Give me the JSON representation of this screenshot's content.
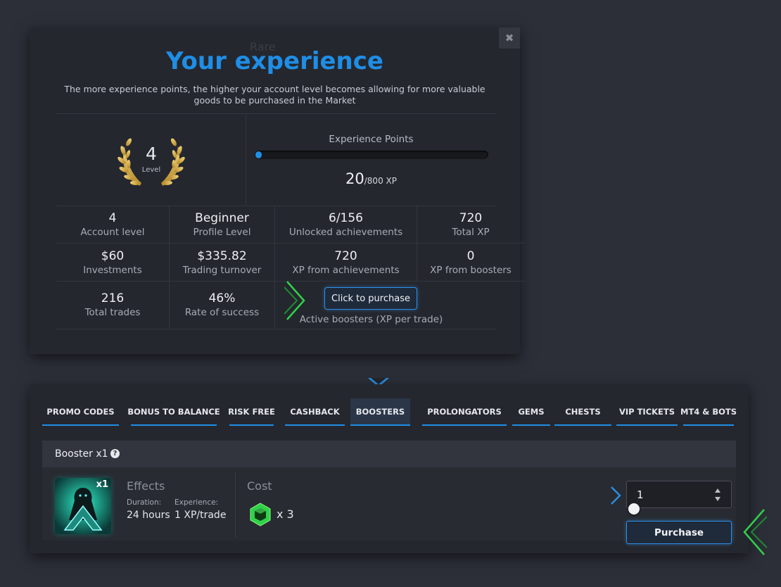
{
  "modal": {
    "bg_text": "Rare",
    "close_glyph": "✖",
    "title": "Your experience",
    "description": "The more experience points, the higher your account level becomes allowing for more valuable goods to be purchased in the Market",
    "level": {
      "value": "4",
      "label": "Level"
    },
    "xp": {
      "label": "Experience Points",
      "current": "20",
      "max": "/800 XP",
      "progress_fraction": 0.025
    },
    "stats": [
      {
        "value": "4",
        "label": "Account level"
      },
      {
        "value": "Beginner",
        "label": "Profile Level"
      },
      {
        "value": "6/156",
        "label": "Unlocked achievements"
      },
      {
        "value": "720",
        "label": "Total XP"
      },
      {
        "value": "$60",
        "label": "Investments"
      },
      {
        "value": "$335.82",
        "label": "Trading turnover"
      },
      {
        "value": "720",
        "label": "XP from achievements"
      },
      {
        "value": "0",
        "label": "XP from boosters"
      },
      {
        "value": "216",
        "label": "Total trades"
      },
      {
        "value": "46%",
        "label": "Rate of success"
      }
    ],
    "purchase_link": "Click to purchase",
    "boosters_label": "Active boosters (XP per trade)"
  },
  "tabs": [
    {
      "label": "PROMO CODES"
    },
    {
      "label": "BONUS TO BALANCE"
    },
    {
      "label": "RISK FREE"
    },
    {
      "label": "CASHBACK"
    },
    {
      "label": "BOOSTERS",
      "active": true
    },
    {
      "label": "PROLONGATORS"
    },
    {
      "label": "GEMS"
    },
    {
      "label": "CHESTS"
    },
    {
      "label": "VIP TICKETS"
    },
    {
      "label": "MT4 & BOTS"
    }
  ],
  "booster": {
    "title": "Booster x1",
    "help_glyph": "?",
    "multiplier": "x1",
    "effects_heading": "Effects",
    "duration_label": "Duration:",
    "duration_value": "24 hours",
    "experience_label": "Experience:",
    "experience_value": "1 XP/trade",
    "cost_heading": "Cost",
    "cost_value": "x 3",
    "quantity": "1",
    "purchase_button": "Purchase"
  },
  "colors": {
    "accent": "#1e8ee6",
    "green": "#2fd14a",
    "background": "#2c2f38"
  }
}
